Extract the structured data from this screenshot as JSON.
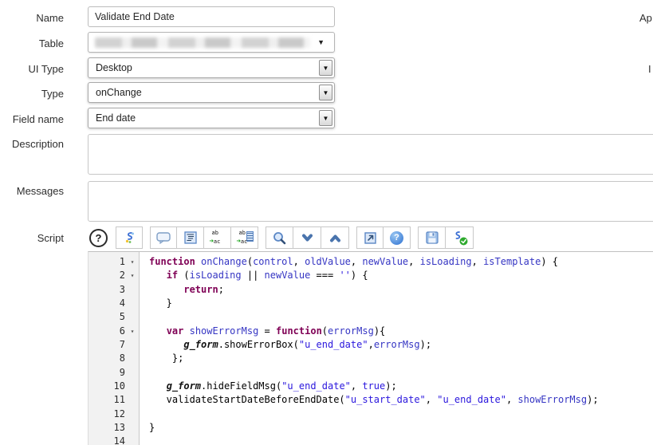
{
  "form": {
    "name": {
      "label": "Name",
      "value": "Validate End Date"
    },
    "table": {
      "label": "Table",
      "value_redacted": true
    },
    "ui_type": {
      "label": "UI Type",
      "value": "Desktop"
    },
    "type": {
      "label": "Type",
      "value": "onChange"
    },
    "field_name": {
      "label": "Field name",
      "value": "End date"
    },
    "description": {
      "label": "Description",
      "value": ""
    },
    "messages": {
      "label": "Messages",
      "value": ""
    },
    "script": {
      "label": "Script"
    }
  },
  "right_column": {
    "label_1": "Ap",
    "label_2": "I"
  },
  "glyphs": {
    "caret_down": "▼",
    "fold_arrow": "▾",
    "help": "?",
    "replace_from": "ab",
    "replace_to": "ac",
    "replace_arrow": "➜"
  },
  "toolbar_buttons": [
    "help",
    "toggle-syntax-editor",
    "comment",
    "format-code",
    "replace",
    "replace-all",
    "search",
    "find-next",
    "find-previous",
    "open-in-new-window",
    "help-reference",
    "save",
    "check-syntax"
  ],
  "colors": {
    "keyword": "#7F0055",
    "variable": "#3535c3",
    "string": "#2a16dd",
    "icon_blue": "#5b87c5",
    "icon_dark_blue": "#4a74ad",
    "icon_green": "#1ea51e"
  },
  "editor": {
    "lines": [
      {
        "n": "1",
        "fold": true,
        "t": [
          [
            "k",
            "function"
          ],
          [
            "p",
            " "
          ],
          [
            "v",
            "onChange"
          ],
          [
            "p",
            "("
          ],
          [
            "v",
            "control"
          ],
          [
            "p",
            ", "
          ],
          [
            "v",
            "oldValue"
          ],
          [
            "p",
            ", "
          ],
          [
            "v",
            "newValue"
          ],
          [
            "p",
            ", "
          ],
          [
            "v",
            "isLoading"
          ],
          [
            "p",
            ", "
          ],
          [
            "v",
            "isTemplate"
          ],
          [
            "p",
            ") {"
          ]
        ]
      },
      {
        "n": "2",
        "fold": true,
        "t": [
          [
            "p",
            "   "
          ],
          [
            "k",
            "if"
          ],
          [
            "p",
            " ("
          ],
          [
            "v",
            "isLoading"
          ],
          [
            "p",
            " || "
          ],
          [
            "v",
            "newValue"
          ],
          [
            "p",
            " === "
          ],
          [
            "s",
            "''"
          ],
          [
            "p",
            ") {"
          ]
        ]
      },
      {
        "n": "3",
        "t": [
          [
            "p",
            "      "
          ],
          [
            "k",
            "return"
          ],
          [
            "p",
            ";"
          ]
        ]
      },
      {
        "n": "4",
        "t": [
          [
            "p",
            "   }"
          ]
        ]
      },
      {
        "n": "5",
        "t": []
      },
      {
        "n": "6",
        "fold": true,
        "t": [
          [
            "p",
            "   "
          ],
          [
            "k",
            "var"
          ],
          [
            "p",
            " "
          ],
          [
            "v",
            "showErrorMsg"
          ],
          [
            "p",
            " = "
          ],
          [
            "k",
            "function"
          ],
          [
            "p",
            "("
          ],
          [
            "v",
            "errorMsg"
          ],
          [
            "p",
            "){"
          ]
        ]
      },
      {
        "n": "7",
        "t": [
          [
            "p",
            "      "
          ],
          [
            "g",
            "g_form"
          ],
          [
            "p",
            ".showErrorBox("
          ],
          [
            "s",
            "\"u_end_date\""
          ],
          [
            "p",
            ","
          ],
          [
            "v",
            "errorMsg"
          ],
          [
            "p",
            ");"
          ]
        ]
      },
      {
        "n": "8",
        "t": [
          [
            "p",
            "    };"
          ]
        ]
      },
      {
        "n": "9",
        "t": []
      },
      {
        "n": "10",
        "t": [
          [
            "p",
            "   "
          ],
          [
            "g",
            "g_form"
          ],
          [
            "p",
            ".hideFieldMsg("
          ],
          [
            "s",
            "\"u_end_date\""
          ],
          [
            "p",
            ", "
          ],
          [
            "a",
            "true"
          ],
          [
            "p",
            ");"
          ]
        ]
      },
      {
        "n": "11",
        "t": [
          [
            "p",
            "   validateStartDateBeforeEndDate("
          ],
          [
            "s",
            "\"u_start_date\""
          ],
          [
            "p",
            ", "
          ],
          [
            "s",
            "\"u_end_date\""
          ],
          [
            "p",
            ", "
          ],
          [
            "v",
            "showErrorMsg"
          ],
          [
            "p",
            ");"
          ]
        ]
      },
      {
        "n": "12",
        "t": []
      },
      {
        "n": "13",
        "t": [
          [
            "p",
            "}"
          ]
        ]
      },
      {
        "n": "14",
        "t": []
      }
    ]
  }
}
